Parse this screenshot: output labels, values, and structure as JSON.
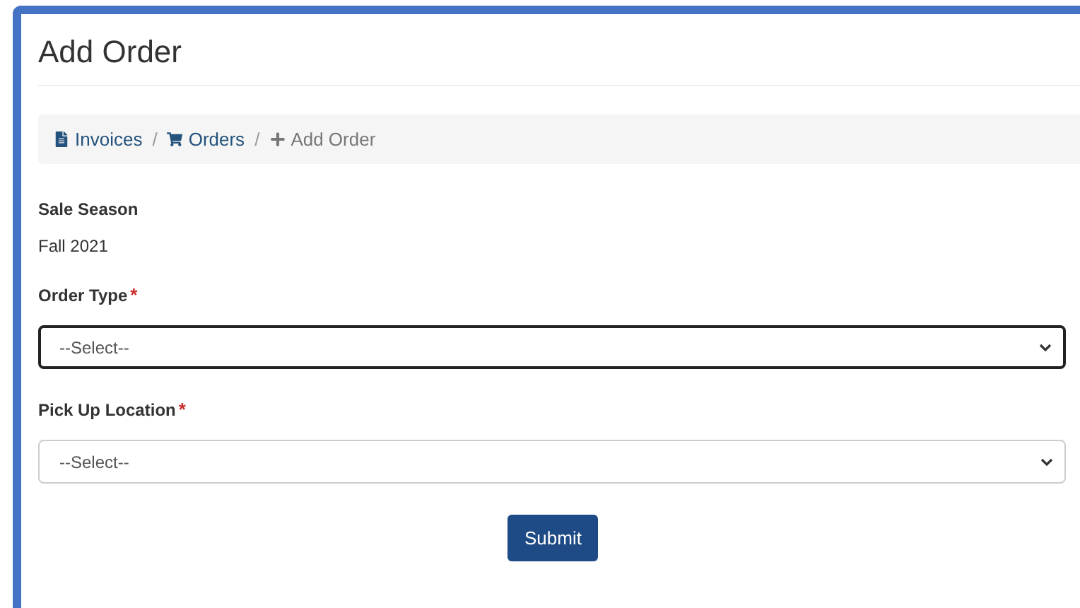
{
  "page": {
    "title": "Add Order"
  },
  "breadcrumb": {
    "separator": "/",
    "items": [
      {
        "label": "Invoices",
        "current": false
      },
      {
        "label": "Orders",
        "current": false
      },
      {
        "label": "Add Order",
        "current": true
      }
    ]
  },
  "info": {
    "label": "Sale Season",
    "value": "Fall 2021"
  },
  "fields": [
    {
      "label": "Order Type",
      "required_mark": "*",
      "value": "--Select--",
      "focused": true
    },
    {
      "label": "Pick Up Location",
      "required_mark": "*",
      "value": "--Select--",
      "focused": false
    }
  ],
  "submit": {
    "label": "Submit"
  }
}
